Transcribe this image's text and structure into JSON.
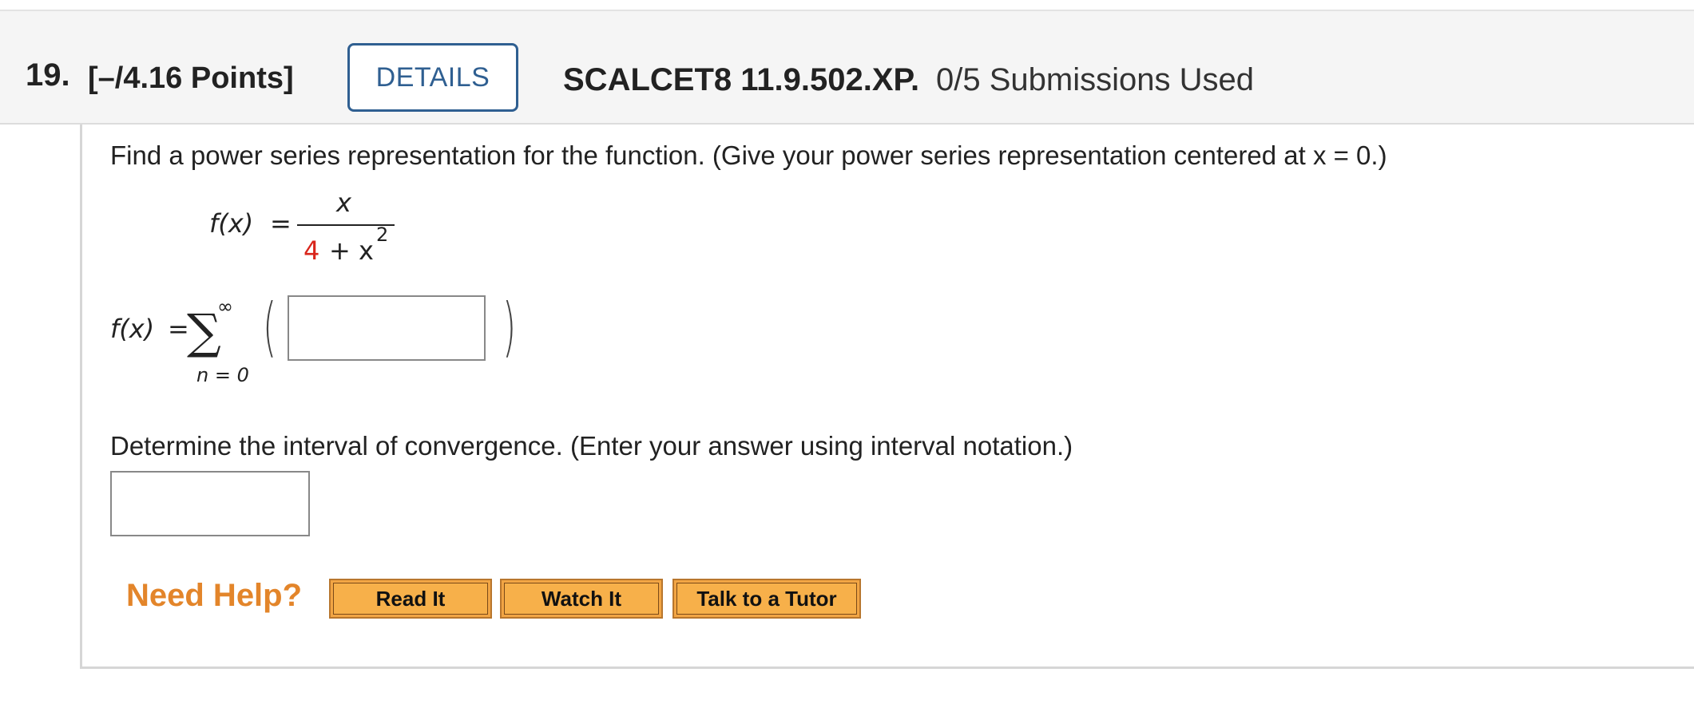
{
  "header": {
    "question_number": "19.",
    "points": "[–/4.16 Points]",
    "details_label": "DETAILS",
    "problem_id": "SCALCET8 11.9.502.XP.",
    "submissions": "0/5 Submissions Used"
  },
  "question": {
    "prompt": "Find a power series representation for the function. (Give your power series representation centered at x = 0.)",
    "function": {
      "lhs": "f(x)",
      "equals": "=",
      "numerator": "x",
      "denominator_constant": "4",
      "denominator_rest": "+ x",
      "exponent": "2"
    },
    "series": {
      "lhs": "f(x)",
      "equals": "=",
      "sum_symbol": "∑",
      "upper_limit": "∞",
      "lower_limit": "n = 0",
      "open_paren": "(",
      "close_paren": ")",
      "answer_value": ""
    },
    "interval_prompt": "Determine the interval of convergence. (Enter your answer using interval notation.)",
    "interval_value": ""
  },
  "help": {
    "label": "Need Help?",
    "buttons": [
      "Read It",
      "Watch It",
      "Talk to a Tutor"
    ]
  },
  "colors": {
    "details_border": "#2f5f91",
    "need_help": "#e3852a",
    "help_button": "#f2a544",
    "red_constant": "#d9261c"
  }
}
